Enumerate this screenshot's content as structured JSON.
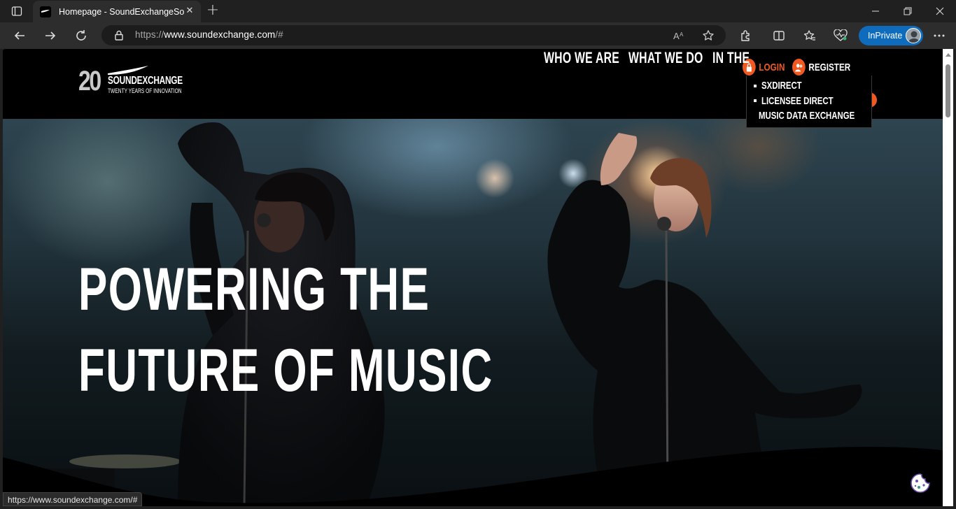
{
  "browser": {
    "tab": {
      "title": "Homepage - SoundExchangeSoundExchange",
      "favicon": "soundexchange-favicon"
    },
    "address": {
      "scheme": "https://",
      "domain": "www.soundexchange.com",
      "path": "/#"
    },
    "inprivate_label": "InPrivate",
    "status_url": "https://www.soundexchange.com/#",
    "icons": [
      "tab-actions-icon",
      "close-icon",
      "new-tab-icon",
      "minimize-icon",
      "restore-icon",
      "close-window-icon",
      "back-icon",
      "forward-icon",
      "refresh-icon",
      "lock-icon",
      "read-aloud-icon",
      "favorite-star-icon",
      "extensions-icon",
      "split-screen-icon",
      "favorites-icon",
      "browser-essentials-icon",
      "more-icon"
    ]
  },
  "site": {
    "logo": {
      "number": "20",
      "name": "SOUNDEXCHANGE",
      "tagline": "TWENTY YEARS OF INNOVATION"
    },
    "account": {
      "login": "LOGIN",
      "register": "REGISTER"
    },
    "nav": [
      "WHO WE ARE",
      "WHAT WE DO",
      "IN THE"
    ],
    "login_dropdown": [
      "SXDIRECT",
      "LICENSEE DIRECT",
      "MUSIC DATA EXCHANGE"
    ],
    "hero": {
      "line1": "POWERING THE",
      "line2": "FUTURE OF MUSIC"
    },
    "colors": {
      "accent": "#f05a22",
      "header_bg": "#000000",
      "text": "#ffffff"
    }
  }
}
